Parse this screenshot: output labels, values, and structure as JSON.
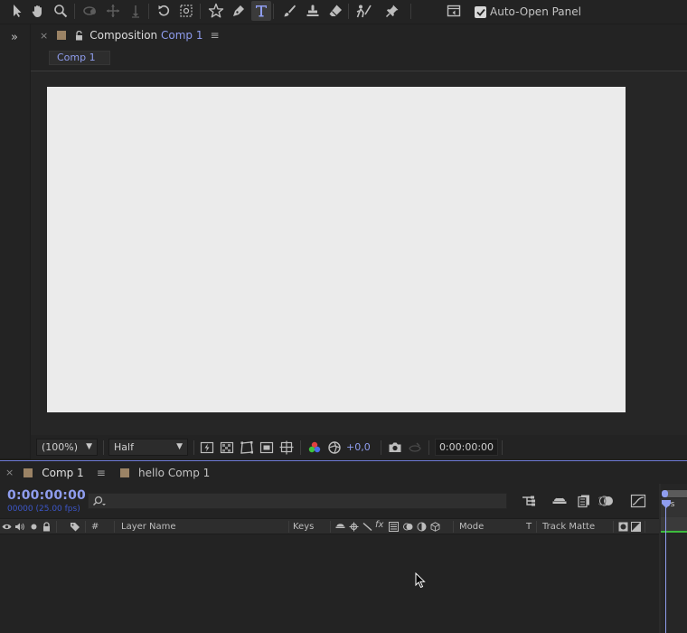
{
  "toolbar": {
    "tools": [
      "selection-tool",
      "hand-tool",
      "zoom-tool",
      "orbit-camera-tool",
      "pan-camera-tool",
      "dolly-camera-tool",
      "rotation-tool",
      "pan-behind-tool",
      "shape-tool",
      "pen-tool",
      "type-tool",
      "brush-tool",
      "clone-stamp-tool",
      "eraser-tool",
      "roto-brush-tool",
      "puppet-pin-tool"
    ],
    "active_tool": "type-tool",
    "auto_open_panel_label": "Auto-Open Panel",
    "auto_open_panel_checked": true
  },
  "composition_panel": {
    "title_prefix": "Composition",
    "title_name": "Comp 1",
    "subtab": "Comp 1",
    "canvas_color": "#ebebeb",
    "controls": {
      "magnification": "(100%)",
      "resolution": "Half",
      "exposure": "+0,0",
      "current_time": "0:00:00:00"
    }
  },
  "timeline_panel": {
    "tabs": [
      {
        "label": "Comp 1",
        "active": true
      },
      {
        "label": "hello Comp 1",
        "active": false
      }
    ],
    "timecode": "0:00:00:00",
    "fps_label": "00000 (25.00 fps)",
    "ruler_label": "0s",
    "columns": {
      "number": "#",
      "layer_name": "Layer Name",
      "keys": "Keys",
      "mode": "Mode",
      "t": "T",
      "track_matte": "Track Matte"
    }
  },
  "colors": {
    "accent": "#8f9dee",
    "panel_bg": "#232323",
    "label_swatch": "#9b8365"
  }
}
